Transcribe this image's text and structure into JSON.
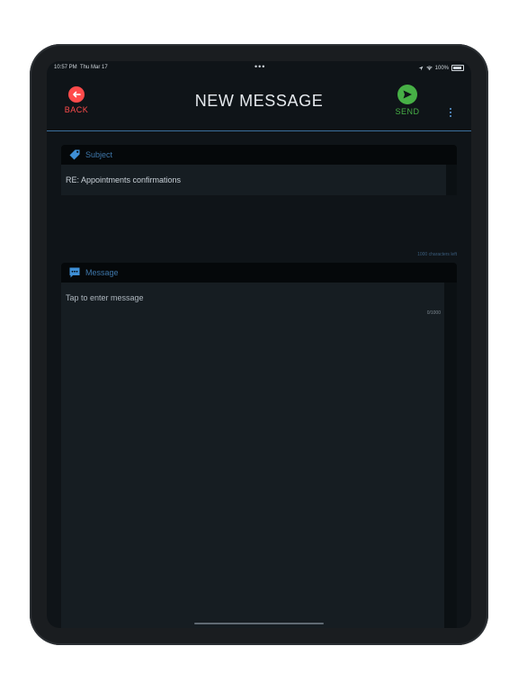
{
  "status_bar": {
    "time": "10:57 PM",
    "date": "Thu Mar 17",
    "dots": "•••",
    "battery": "100%"
  },
  "header": {
    "back_label": "BACK",
    "title": "NEW MESSAGE",
    "send_label": "SEND"
  },
  "subject": {
    "label": "Subject",
    "value": "RE: Appointments confirmations",
    "chars_left": "1000 characters left"
  },
  "message": {
    "label": "Message",
    "placeholder": "Tap to enter message",
    "counter": "0/1000"
  },
  "colors": {
    "back": "#ff4b4b",
    "send": "#47b046",
    "accent": "#3e76a9"
  }
}
